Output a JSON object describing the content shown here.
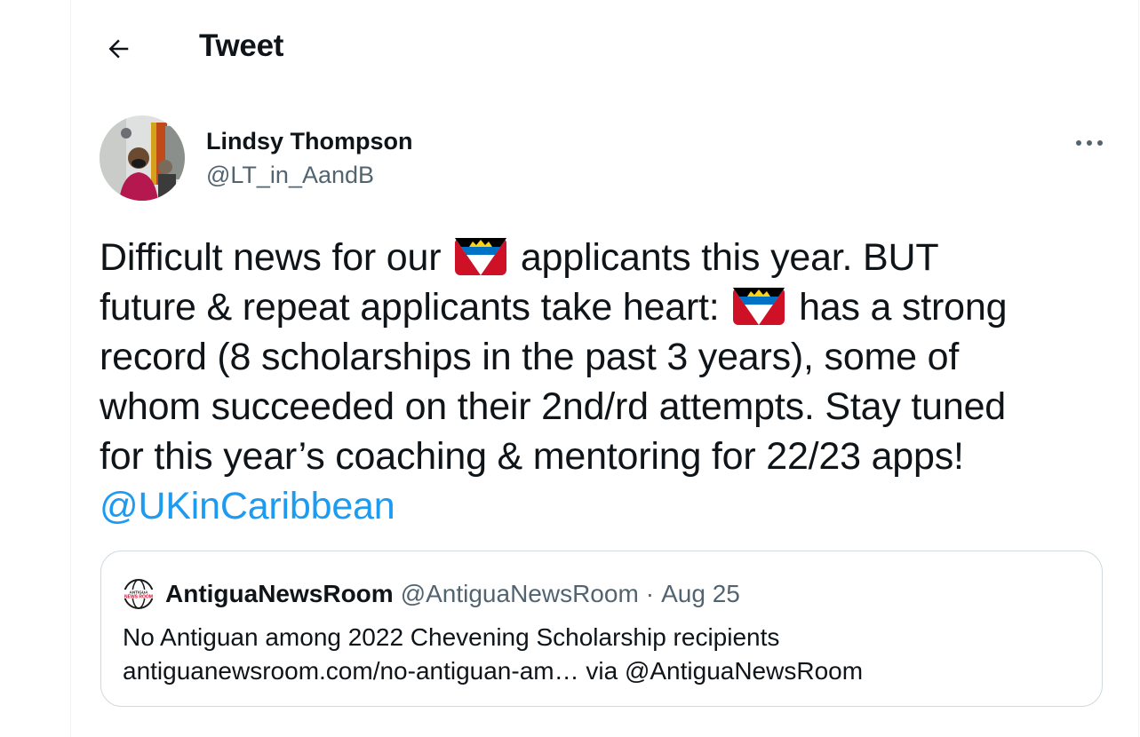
{
  "header": {
    "title": "Tweet",
    "back_icon": "arrow-left-icon"
  },
  "author": {
    "name": "Lindsy Thompson",
    "handle": "@LT_in_AandB",
    "more_icon": "more-dots-icon"
  },
  "tweet": {
    "segments": {
      "l1a": "Difficult news for our",
      "l1b": "applicants this year. BUT",
      "l2a": "future & repeat applicants take heart:",
      "l2b": "has a strong",
      "l3": "record (8 scholarships in the past 3 years), some of",
      "l4": "whom succeeded on their 2nd/rd attempts. Stay tuned",
      "l5": "for this year’s coaching & mentoring for 22/23 apps!"
    },
    "mention": "@UKinCaribbean",
    "flag_icon": "antigua-barbuda-flag-icon"
  },
  "quote": {
    "account_name": "AntiguaNewsRoom",
    "handle": "@AntiguaNewsRoom",
    "separator": "·",
    "date": "Aug 25",
    "line1": "No Antiguan among 2022 Chevening Scholarship recipients",
    "line2": "antiguanewsroom.com/no-antiguan-am… via @AntiguaNewsRoom",
    "logo_text_top": "ANTIGUA",
    "logo_text_bottom": "NEWS ROOM"
  },
  "colors": {
    "text": "#0f1419",
    "secondary": "#536471",
    "link": "#1d9bf0",
    "border": "#cfd9de"
  }
}
